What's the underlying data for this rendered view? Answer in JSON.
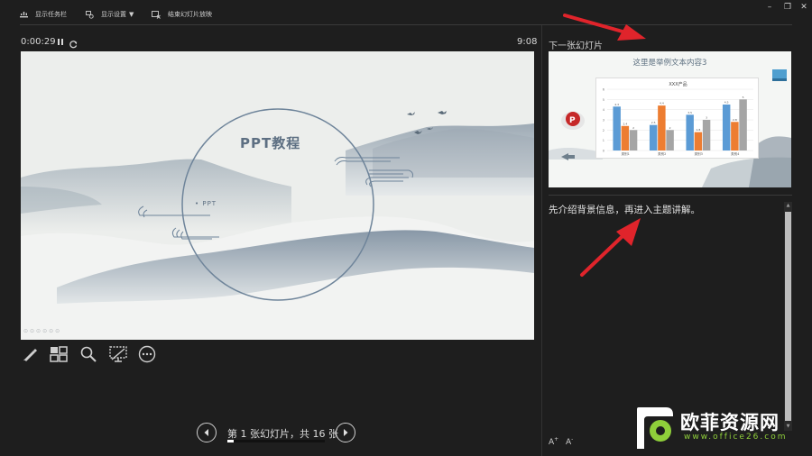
{
  "toolbar": {
    "taskbar_label": "显示任务栏",
    "display_settings_label": "显示设置",
    "end_show_label": "结束幻灯片放映"
  },
  "timer": {
    "elapsed": "0:00:29",
    "clock": "9:08"
  },
  "slide": {
    "title": "PPT教程",
    "subtitle": "• PPT",
    "mini_tools": "⊙⊙⊙⊙⊙⊙"
  },
  "tools": [
    "pen-tool",
    "all-slides",
    "zoom",
    "pointer-options",
    "more-options"
  ],
  "navigation": {
    "label": "第 1 张幻灯片，共 16 张",
    "progress": 0.0625
  },
  "next_slide": {
    "heading": "下一张幻灯片",
    "title": "这里是举例文本内容3",
    "chart_title": "XXX产品"
  },
  "chart_data": {
    "type": "bar",
    "title": "XXX产品",
    "categories": [
      "类别1",
      "类别2",
      "类别3",
      "类别4"
    ],
    "series": [
      {
        "values": [
          4.3,
          2.5,
          3.5,
          4.5
        ]
      },
      {
        "values": [
          2.4,
          4.4,
          1.8,
          2.8
        ]
      },
      {
        "values": [
          2,
          2,
          3,
          5
        ]
      }
    ],
    "ylim": [
      0,
      6
    ],
    "colors": [
      "#5b9bd5",
      "#ed7d31",
      "#a5a5a5"
    ]
  },
  "notes": {
    "text": "先介绍背景信息，再进入主题讲解。"
  },
  "font_controls": {
    "increase": "A",
    "decrease": "A"
  },
  "watermark": {
    "text": "欧菲资源网",
    "url": "www.office26.com"
  },
  "colors": {
    "background": "#1e1e1e",
    "accent_arrow": "#e0242b",
    "slide_ink": "#5d6f82"
  }
}
